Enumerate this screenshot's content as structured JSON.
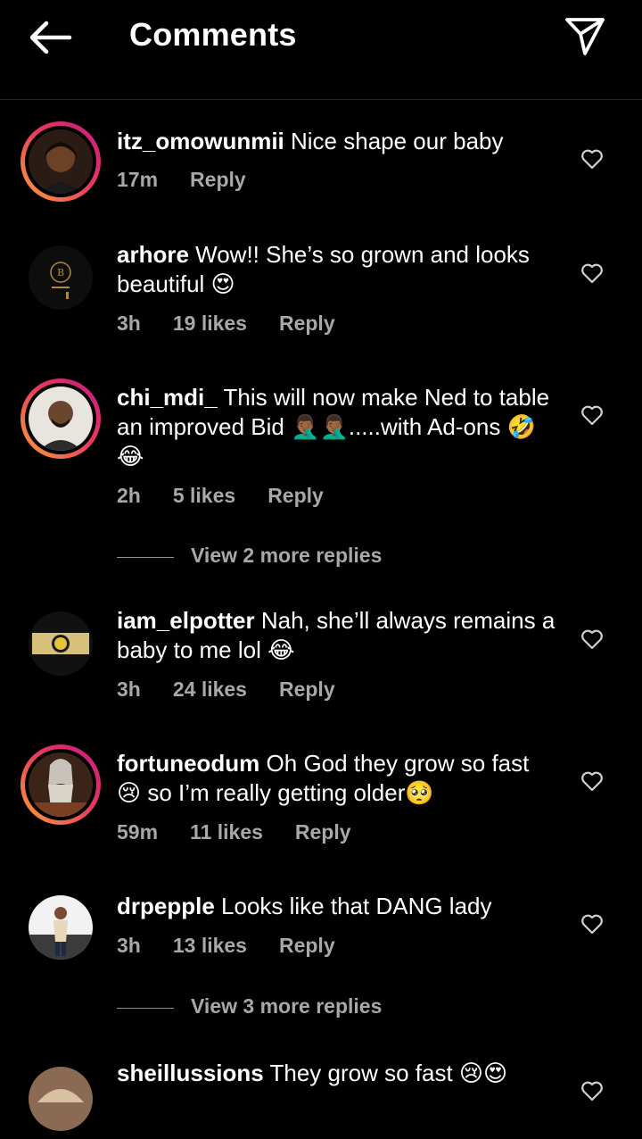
{
  "header": {
    "title": "Comments",
    "back_icon": "back-arrow-icon",
    "send_icon": "send-icon"
  },
  "comments": [
    {
      "user": "itz_omowunmii",
      "text": " Nice shape our baby",
      "time": "17m",
      "likes": "",
      "reply": "Reply"
    },
    {
      "user": "arhore",
      "text": " Wow!! She’s so grown and looks beautiful 😍",
      "time": "3h",
      "likes": "19 likes",
      "reply": "Reply"
    },
    {
      "user": "chi_mdi_",
      "text": " This will now make Ned to table an improved Bid 🤦🏾‍♂️🤦🏾‍♂️.....with Ad-ons 🤣😂",
      "time": "2h",
      "likes": "5 likes",
      "reply": "Reply",
      "more_replies": "View 2 more replies"
    },
    {
      "user": "iam_elpotter",
      "text": " Nah, she’ll always remains a baby to me lol 😂",
      "time": "3h",
      "likes": "24 likes",
      "reply": "Reply"
    },
    {
      "user": "fortuneodum",
      "text": " Oh God they grow so fast 😢 so I’m really getting older🥺",
      "time": "59m",
      "likes": "11 likes",
      "reply": "Reply"
    },
    {
      "user": "drpepple",
      "text": " Looks like that DANG lady",
      "time": "3h",
      "likes": "13 likes",
      "reply": "Reply",
      "more_replies": "View 3 more replies"
    },
    {
      "user": "sheillussions",
      "text": " They grow so fast 😢😍",
      "time": "",
      "likes": "",
      "reply": ""
    }
  ],
  "colors": {
    "background": "#000000",
    "text": "#ffffff",
    "meta": "#a8a8a8",
    "story_ring_start": "#f9a23c",
    "story_ring_end": "#c21c86"
  }
}
